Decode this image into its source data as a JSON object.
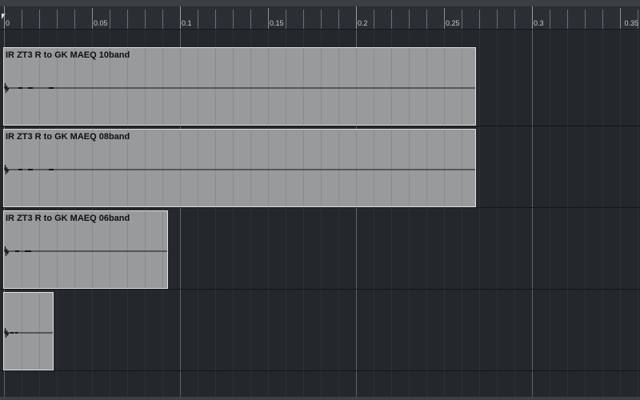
{
  "ruler": {
    "labels": [
      "0",
      "0.05",
      "0.1",
      "0.15",
      "0.2",
      "0.25",
      "0.3",
      "0.35"
    ]
  },
  "events": [
    {
      "title": "IR ZT3 R to GK MAEQ 10band"
    },
    {
      "title": "IR ZT3 R to GK MAEQ 08band"
    },
    {
      "title": "IR ZT3 R to GK MAEQ 06band"
    },
    {
      "title": ""
    }
  ],
  "colors": {
    "background": "#24272b",
    "event_fill": "#999a9b",
    "event_border": "#dfe0e1",
    "waveform": "#111213"
  }
}
